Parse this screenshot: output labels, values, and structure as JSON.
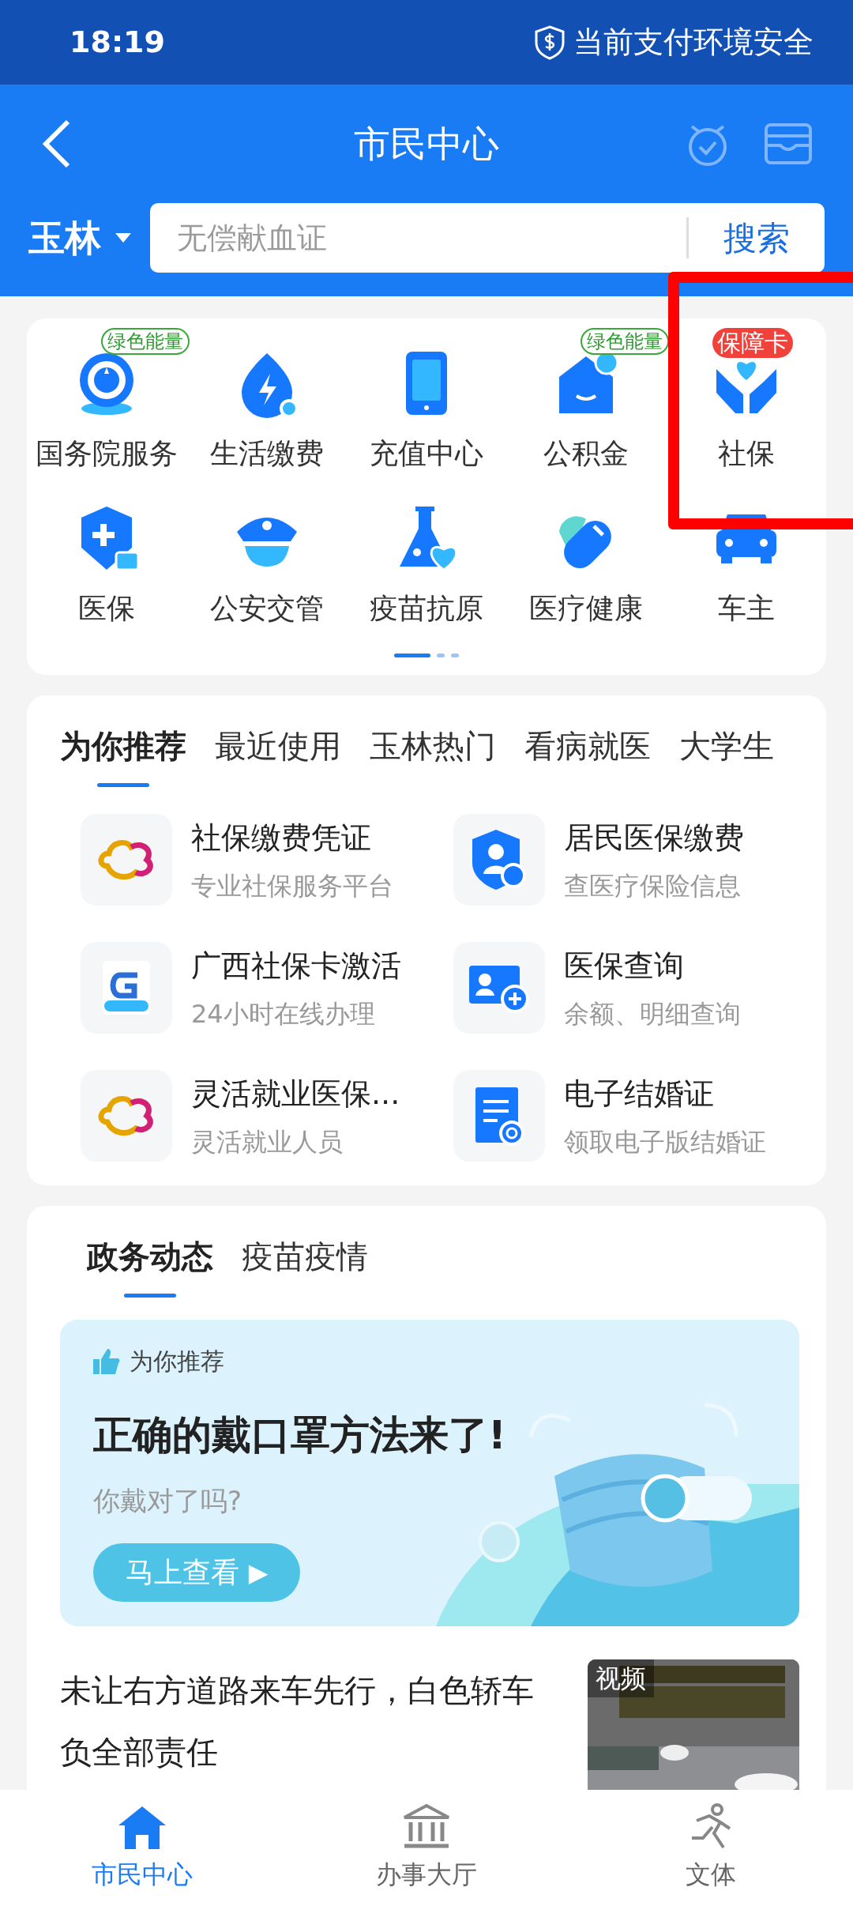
{
  "status_bar": {
    "time": "18:19",
    "security": "当前支付环境安全"
  },
  "header": {
    "title": "市民中心",
    "city": "玉林",
    "search": {
      "placeholder": "无偿献血证",
      "button": "搜索"
    }
  },
  "services": {
    "items": [
      {
        "label": "国务院服务",
        "badge": {
          "text": "绿色能量",
          "kind": "green"
        }
      },
      {
        "label": "生活缴费"
      },
      {
        "label": "充值中心"
      },
      {
        "label": "公积金",
        "badge": {
          "text": "绿色能量",
          "kind": "green"
        }
      },
      {
        "label": "社保",
        "badge": {
          "text": "保障卡",
          "kind": "red"
        }
      },
      {
        "label": "医保"
      },
      {
        "label": "公安交管"
      },
      {
        "label": "疫苗抗原"
      },
      {
        "label": "医疗健康"
      },
      {
        "label": "车主"
      }
    ],
    "pages": [
      {
        "selected": true
      },
      {
        "selected": false
      },
      {
        "selected": false
      }
    ]
  },
  "recommend": {
    "tabs": [
      {
        "label": "为你推荐",
        "selected": true
      },
      {
        "label": "最近使用",
        "selected": false
      },
      {
        "label": "玉林热门",
        "selected": false
      },
      {
        "label": "看病就医",
        "selected": false
      },
      {
        "label": "大学生",
        "selected": false
      }
    ],
    "items": [
      {
        "title": "社保缴费凭证",
        "subtitle": "专业社保服务平台"
      },
      {
        "title": "居民医保缴费",
        "subtitle": "查医疗保险信息"
      },
      {
        "title": "广西社保卡激活",
        "subtitle": "24小时在线办理"
      },
      {
        "title": "医保查询",
        "subtitle": "余额、明细查询"
      },
      {
        "title": "灵活就业医保...",
        "subtitle": "灵活就业人员"
      },
      {
        "title": "电子结婚证",
        "subtitle": "领取电子版结婚证"
      }
    ]
  },
  "news": {
    "tabs": [
      {
        "label": "政务动态",
        "selected": true
      },
      {
        "label": "疫苗疫情",
        "selected": false
      }
    ],
    "banner": {
      "tag": "为你推荐",
      "title": "正确的戴口罩方法来了!",
      "subtitle": "你戴对了吗?",
      "button": "马上查看",
      "button_icon": "▶"
    },
    "article": {
      "title": "未让右方道路来车先行，白色轿车负全部责任",
      "thumbnail_label": "视频"
    }
  },
  "bottom_nav": [
    {
      "label": "市民中心",
      "selected": true
    },
    {
      "label": "办事大厅",
      "selected": false
    },
    {
      "label": "文体",
      "selected": false
    }
  ]
}
